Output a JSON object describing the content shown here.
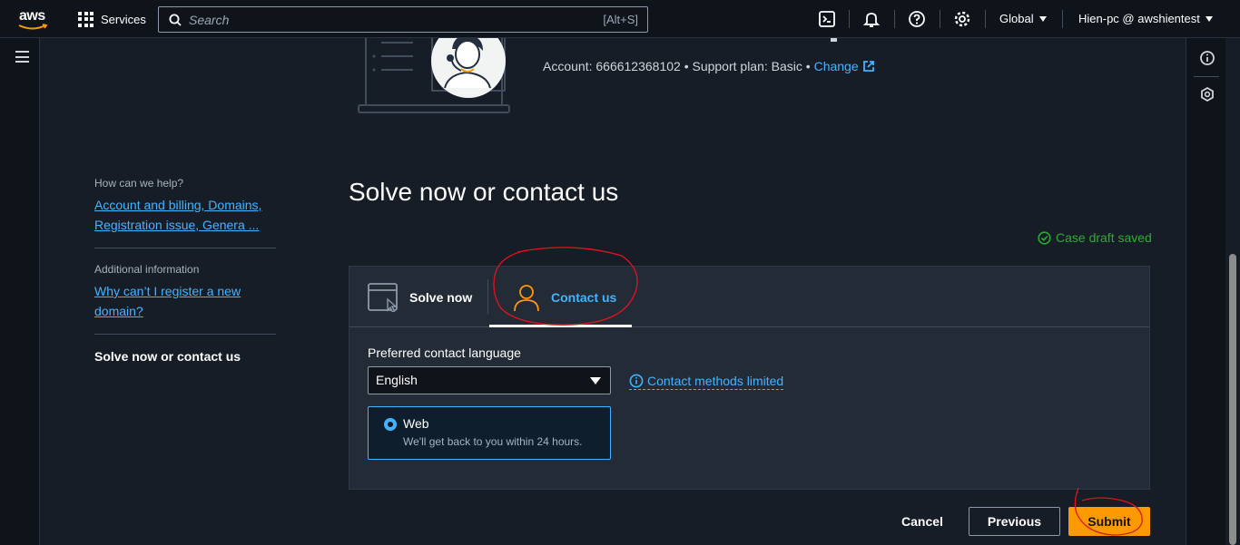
{
  "nav": {
    "logo_text": "aws",
    "services_label": "Services",
    "search_placeholder": "Search",
    "search_shortcut": "[Alt+S]",
    "region_label": "Global",
    "user_label": "Hien-pc @ awshientest"
  },
  "header": {
    "account_text": "Account: 666612368102 • Support plan: Basic • ",
    "change_link": "Change"
  },
  "steps": [
    {
      "label": "How can we help?",
      "link": "Account and billing, Domains, Registration issue, Genera ..."
    },
    {
      "label": "Additional information",
      "link": "Why can’t I register a new domain?"
    },
    {
      "current": "Solve now or contact us"
    }
  ],
  "page": {
    "title": "Solve now or contact us",
    "draft_status": "Case draft saved"
  },
  "tabs": [
    {
      "label": "Solve now",
      "active": false
    },
    {
      "label": "Contact us",
      "active": true
    }
  ],
  "contact": {
    "language_label": "Preferred contact language",
    "language_value": "English",
    "limited_link": "Contact methods limited",
    "method_title": "Web",
    "method_desc": "We'll get back to you within 24 hours."
  },
  "actions": {
    "cancel": "Cancel",
    "previous": "Previous",
    "submit": "Submit"
  },
  "colors": {
    "accent_link": "#42b4ff",
    "primary_button": "#ff9900",
    "success": "#29ad32",
    "annotation": "#e0141e"
  }
}
